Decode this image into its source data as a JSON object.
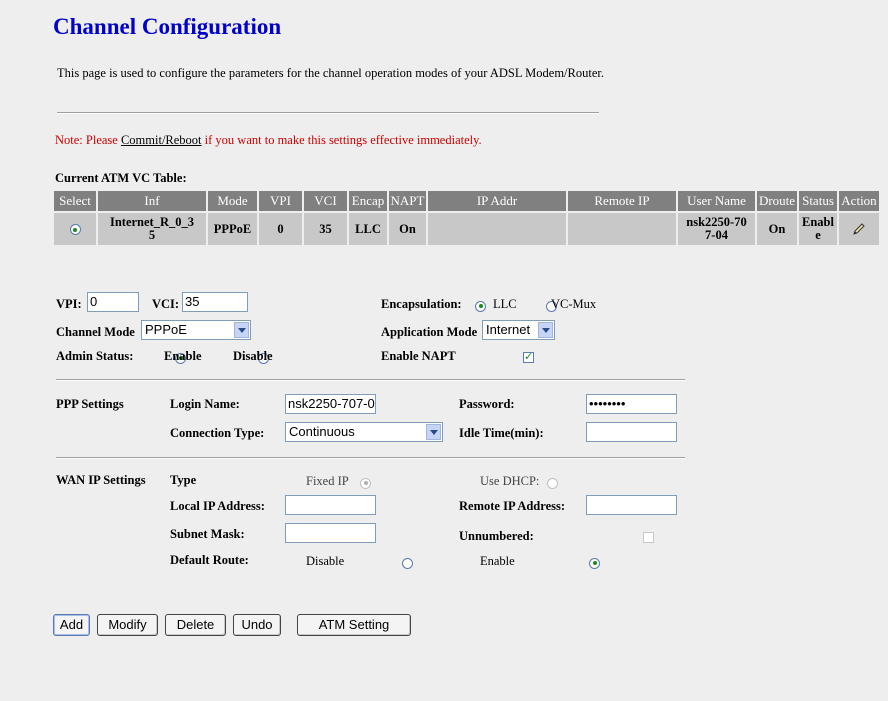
{
  "page": {
    "title": "Channel Configuration",
    "description": "This page is used to configure the parameters for the channel operation modes of your ADSL Modem/Router.",
    "note_prefix": "Note: Please ",
    "note_link": "Commit/Reboot",
    "note_suffix": " if you want to make this settings effective immediately."
  },
  "vc_table": {
    "caption": "Current ATM VC Table:",
    "headers": [
      "Select",
      "Inf",
      "Mode",
      "VPI",
      "VCI",
      "Encap",
      "NAPT",
      "IP Addr",
      "Remote IP",
      "User Name",
      "Droute",
      "Status",
      "Action"
    ],
    "rows": [
      {
        "inf_line1": "Internet_R_0_3",
        "inf_line2": "5",
        "mode": "PPPoE",
        "vpi": "0",
        "vci": "35",
        "encap": "LLC",
        "napt": "On",
        "ip_addr": "",
        "remote_ip": "",
        "user_line1": "nsk2250-70",
        "user_line2": "7-04",
        "droute": "On",
        "status_line1": "Enabl",
        "status_line2": "e",
        "action_icon": "pencil-icon"
      }
    ]
  },
  "channel": {
    "vpi_label": "VPI:",
    "vpi_value": "0",
    "vci_label": "VCI:",
    "vci_value": "35",
    "encap_label": "Encapsulation:",
    "encap_llc": "LLC",
    "encap_vcmux": "VC-Mux",
    "mode_label": "Channel Mode",
    "mode_value": "PPPoE",
    "app_mode_label": "Application Mode",
    "app_mode_value": "Internet",
    "admin_label": "Admin Status:",
    "admin_enable": "Enable",
    "admin_disable": "Disable",
    "napt_label": "Enable NAPT"
  },
  "ppp": {
    "section": "PPP Settings",
    "login_label": "Login Name:",
    "login_value": "nsk2250-707-0",
    "password_label": "Password:",
    "password_value": "••••••••",
    "conn_label": "Connection Type:",
    "conn_value": "Continuous",
    "idle_label": "Idle Time(min):",
    "idle_value": ""
  },
  "wan": {
    "section": "WAN IP Settings",
    "type_label": "Type",
    "fixed_ip": "Fixed IP",
    "use_dhcp": "Use DHCP:",
    "local_ip_label": "Local IP Address:",
    "remote_ip_label": "Remote IP Address:",
    "subnet_label": "Subnet Mask:",
    "unnumbered_label": "Unnumbered:",
    "default_route_label": "Default Route:",
    "dr_disable": "Disable",
    "dr_enable": "Enable"
  },
  "buttons": {
    "add": "Add",
    "modify": "Modify",
    "delete": "Delete",
    "undo": "Undo",
    "atm": "ATM Setting"
  }
}
